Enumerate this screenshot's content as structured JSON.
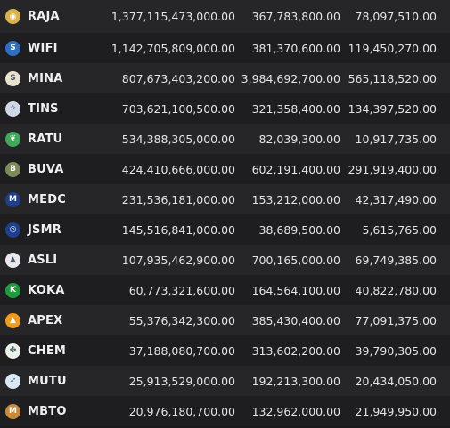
{
  "rows": [
    {
      "ticker": "RAJA",
      "icon": "raja-logo-icon",
      "color": "#d9b24a",
      "glyph": "◉",
      "v1": "1,377,115,473,000.00",
      "v2": "367,783,800.00",
      "v3": "78,097,510.00"
    },
    {
      "ticker": "WIFI",
      "icon": "wifi-logo-icon",
      "color": "#2d6fc2",
      "glyph": "S",
      "v1": "1,142,705,809,000.00",
      "v2": "381,370,600.00",
      "v3": "119,450,270.00"
    },
    {
      "ticker": "MINA",
      "icon": "mina-logo-icon",
      "color": "#e8e2cf",
      "glyph": "S",
      "v1": "807,673,403,200.00",
      "v2": "3,984,692,700.00",
      "v3": "565,118,520.00"
    },
    {
      "ticker": "TINS",
      "icon": "tins-logo-icon",
      "color": "#cfd8e6",
      "glyph": "✧",
      "v1": "703,621,100,500.00",
      "v2": "321,358,400.00",
      "v3": "134,397,520.00"
    },
    {
      "ticker": "RATU",
      "icon": "ratu-logo-icon",
      "color": "#3fa85a",
      "glyph": "❦",
      "v1": "534,388,305,000.00",
      "v2": "82,039,300.00",
      "v3": "10,917,735.00"
    },
    {
      "ticker": "BUVA",
      "icon": "buva-logo-icon",
      "color": "#7d8a5a",
      "glyph": "B",
      "v1": "424,410,666,000.00",
      "v2": "602,191,400.00",
      "v3": "291,919,400.00"
    },
    {
      "ticker": "MEDC",
      "icon": "medc-logo-icon",
      "color": "#1f3f8a",
      "glyph": "M",
      "v1": "231,536,181,000.00",
      "v2": "153,212,000.00",
      "v3": "42,317,490.00"
    },
    {
      "ticker": "JSMR",
      "icon": "jsmr-logo-icon",
      "color": "#1d3f8f",
      "glyph": "◎",
      "v1": "145,516,841,000.00",
      "v2": "38,689,500.00",
      "v3": "5,615,765.00"
    },
    {
      "ticker": "ASLI",
      "icon": "asli-logo-icon",
      "color": "#e9e9ee",
      "glyph": "▲",
      "v1": "107,935,462,900.00",
      "v2": "700,165,000.00",
      "v3": "69,749,385.00"
    },
    {
      "ticker": "KOKA",
      "icon": "koka-logo-icon",
      "color": "#1f9a3c",
      "glyph": "K",
      "v1": "60,773,321,600.00",
      "v2": "164,564,100.00",
      "v3": "40,822,780.00"
    },
    {
      "ticker": "APEX",
      "icon": "apex-logo-icon",
      "color": "#f29a1c",
      "glyph": "▲",
      "v1": "55,376,342,300.00",
      "v2": "385,430,400.00",
      "v3": "77,091,375.00"
    },
    {
      "ticker": "CHEM",
      "icon": "chem-logo-icon",
      "color": "#e9f2e6",
      "glyph": "✤",
      "v1": "37,188,080,700.00",
      "v2": "313,602,200.00",
      "v3": "39,790,305.00"
    },
    {
      "ticker": "MUTU",
      "icon": "mutu-logo-icon",
      "color": "#d8e8f4",
      "glyph": "➶",
      "v1": "25,913,529,000.00",
      "v2": "192,213,300.00",
      "v3": "20,434,050.00"
    },
    {
      "ticker": "MBTO",
      "icon": "mbto-logo-icon",
      "color": "#c98a3a",
      "glyph": "M",
      "v1": "20,976,180,700.00",
      "v2": "132,962,000.00",
      "v3": "21,949,950.00"
    }
  ]
}
